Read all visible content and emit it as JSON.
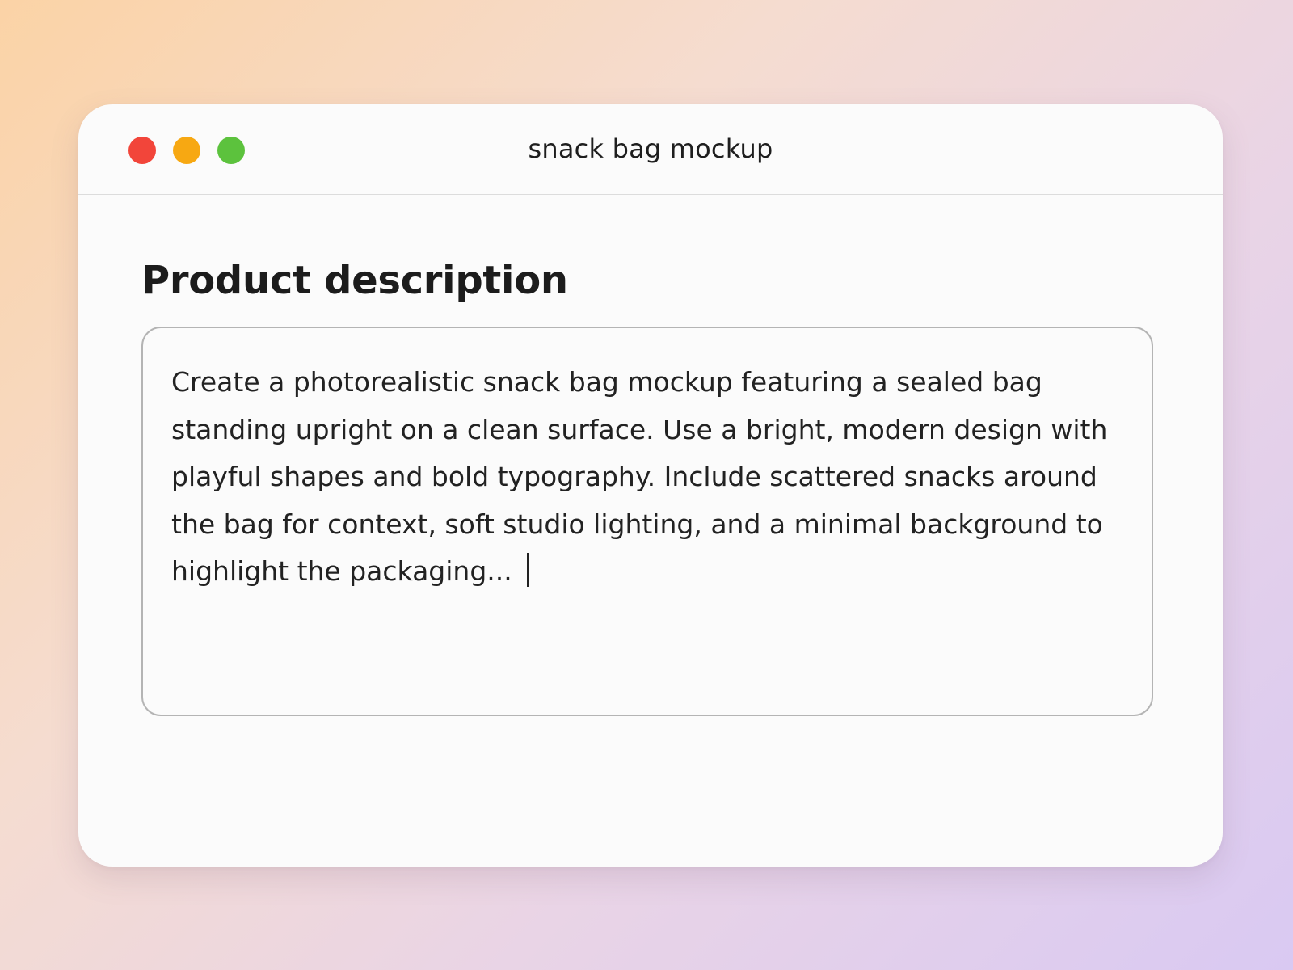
{
  "window": {
    "title": "snack bag mockup",
    "controls": [
      "close",
      "minimize",
      "zoom"
    ],
    "colors": {
      "close": "#f2453a",
      "minimize": "#f7a812",
      "zoom": "#5cc23d"
    }
  },
  "main": {
    "heading": "Product description",
    "description": {
      "value": "Create a photorealistic snack bag mockup featuring a sealed bag standing upright on a clean surface. Use a bright, modern design with playful shapes and bold typography. Include scattered snacks around the bag for context, soft studio lighting, and a minimal background to highlight the packaging..."
    }
  }
}
